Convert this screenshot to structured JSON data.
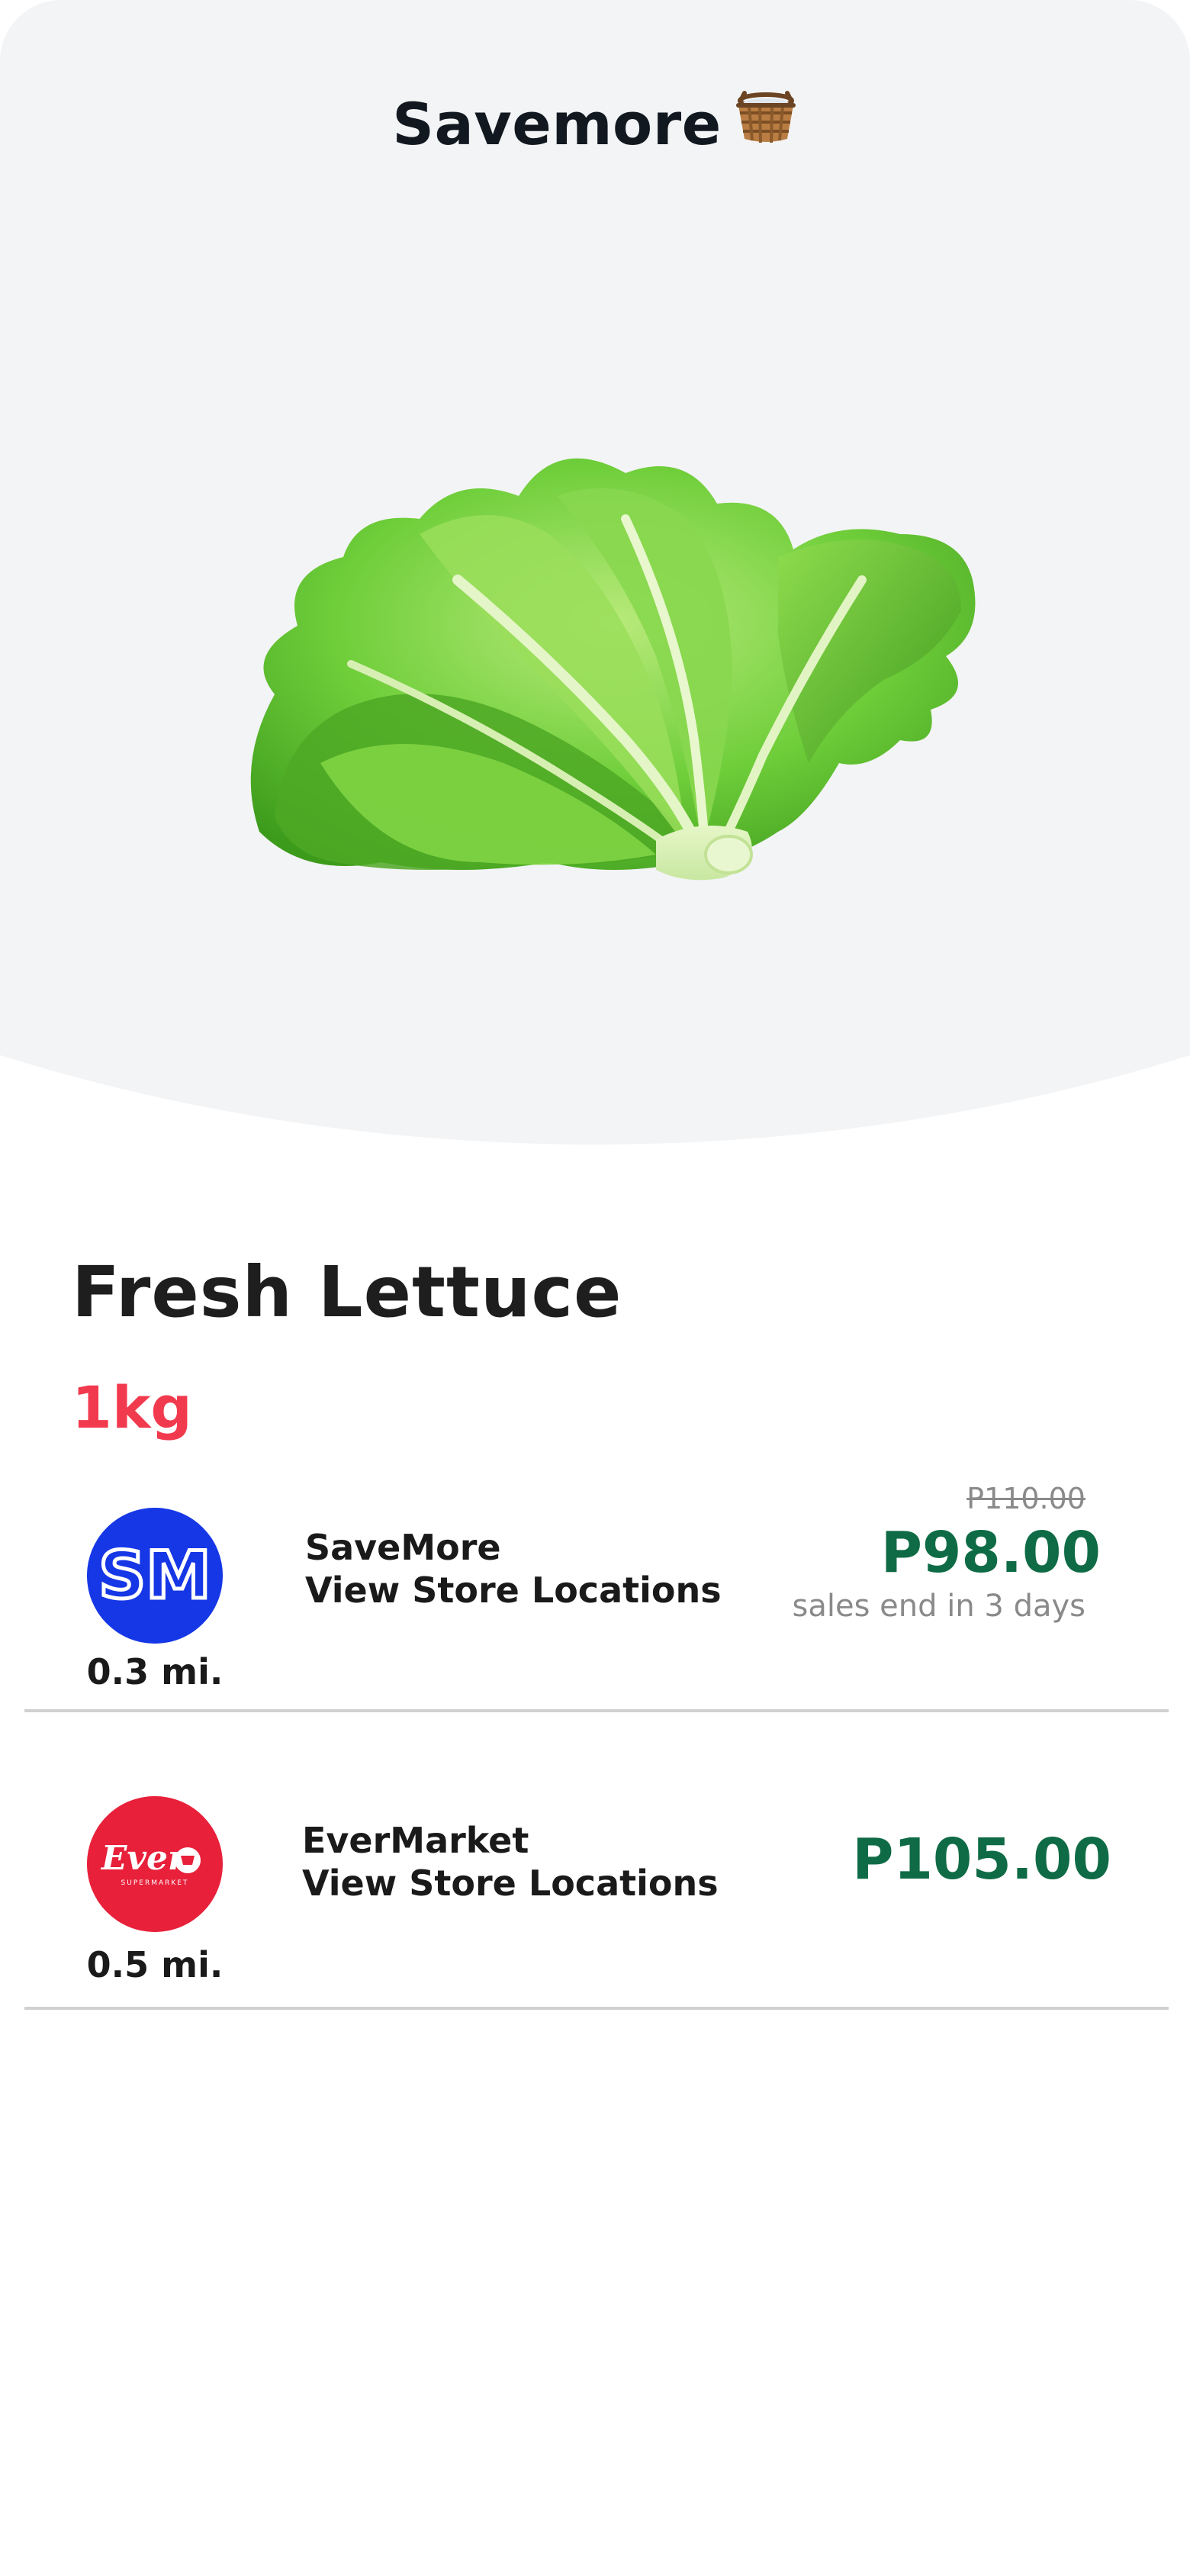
{
  "header": {
    "title": "Savemore",
    "basket_icon": "basket-icon"
  },
  "product": {
    "image_icon": "lettuce-image",
    "name": "Fresh Lettuce",
    "size": "1kg"
  },
  "offers": [
    {
      "logo_icon": "sm-logo",
      "logo_text": "SM",
      "distance": "0.3 mi.",
      "store_name": "SaveMore",
      "locations_link": "View Store Locations",
      "original_price": "P110.00",
      "price": "P98.00",
      "sale_note": "sales end in 3 days"
    },
    {
      "logo_icon": "ever-logo",
      "logo_text": "Ever",
      "logo_subtext": "SUPERMARKET",
      "distance": "0.5 mi.",
      "store_name": "EverMarket",
      "locations_link": "View Store Locations",
      "price": "P105.00"
    }
  ],
  "colors": {
    "hero_background": "#f3f4f6",
    "size_accent": "#f23a4e",
    "price_green": "#0f6b45",
    "sm_blue": "#1637e6",
    "ever_red": "#e8203a"
  }
}
